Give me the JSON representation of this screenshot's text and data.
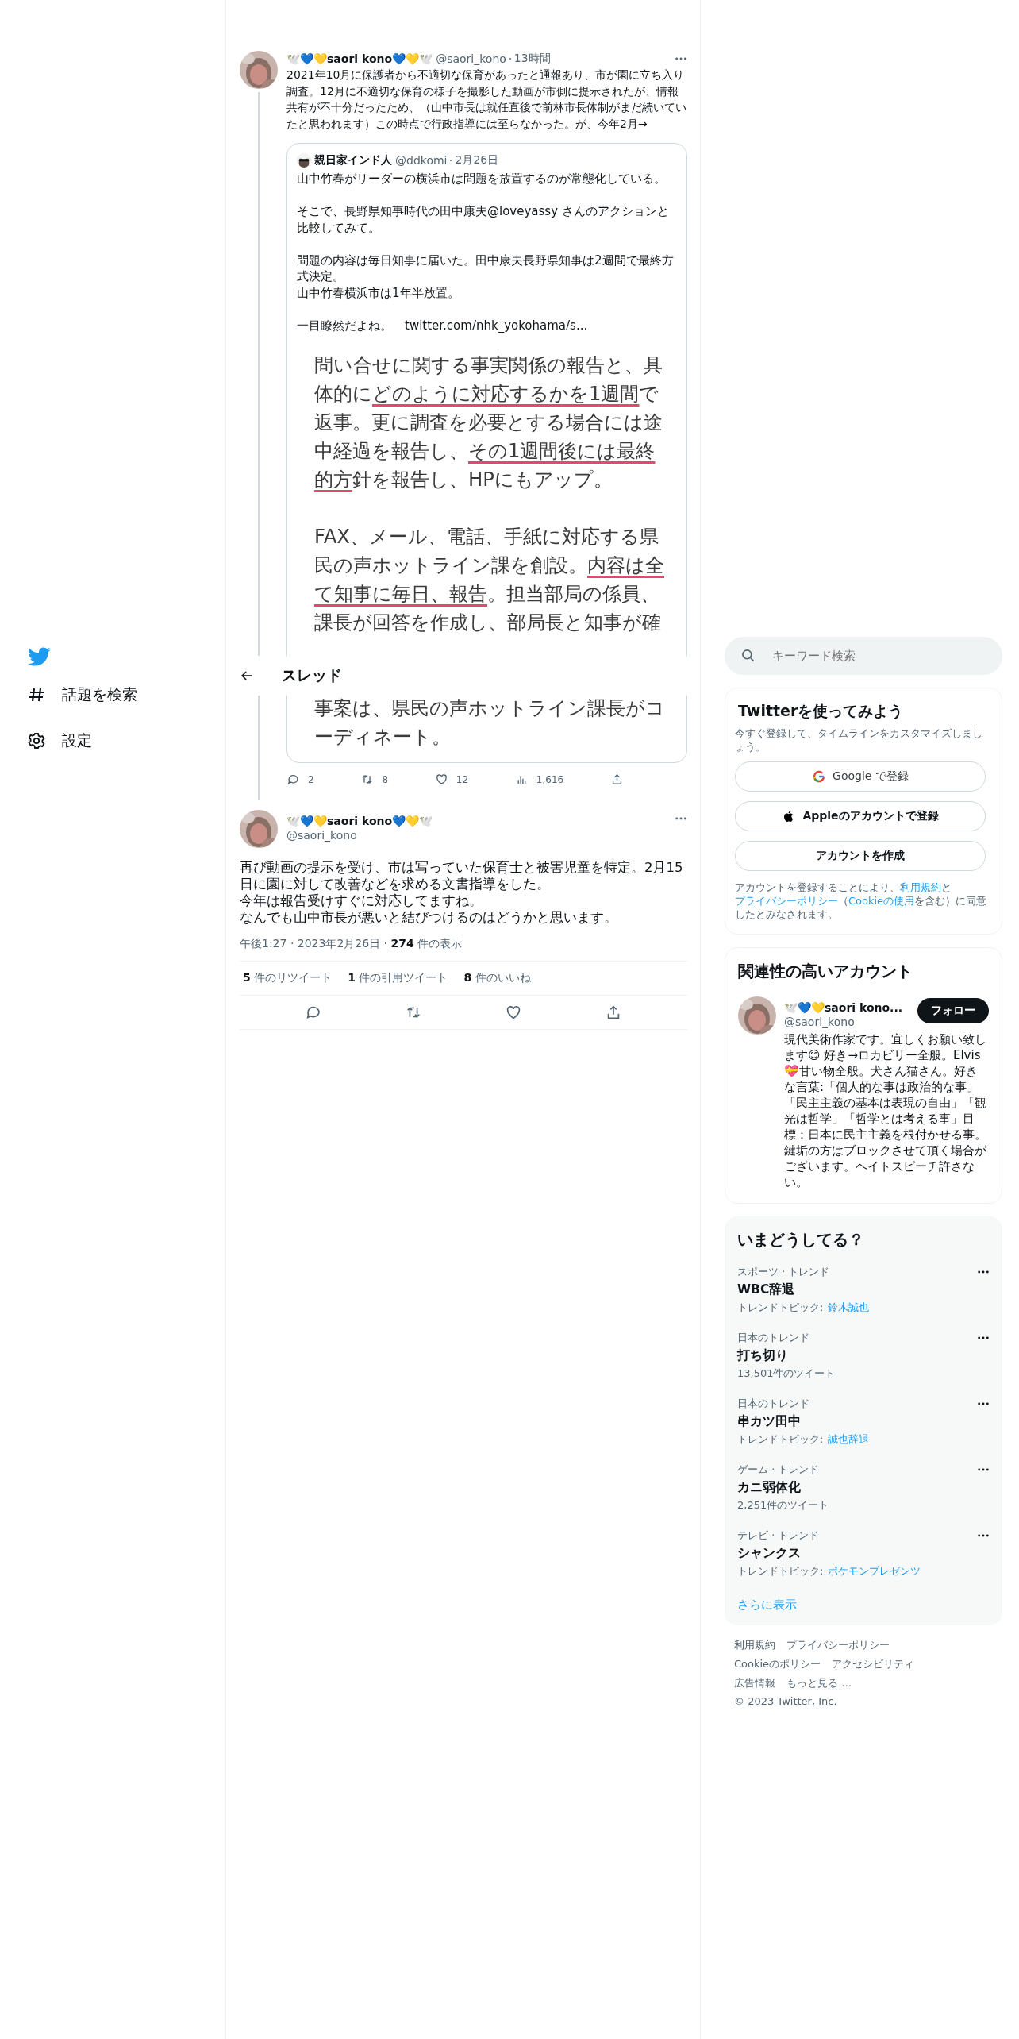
{
  "nav": {
    "items": [
      {
        "label": "話題を検索"
      },
      {
        "label": "設定"
      }
    ]
  },
  "header": {
    "title": "スレッド"
  },
  "tweets": [
    {
      "name": "🕊️💙💛saori kono💙💛🕊️",
      "handle": "@saori_kono",
      "time": "13時間",
      "text": "2021年10月に保護者から不適切な保育があったと通報あり、市が園に立ち入り調査。12月に不適切な保育の様子を撮影した動画が市側に提示されたが、情報共有が不十分だったため、（山中市長は就任直後で前林市長体制がまだ続いていたと思われます）この時点で行政指導には至らなかった。が、今年2月→",
      "quote": {
        "name": "親日家インド人",
        "handle": "@ddkomi",
        "date": "2月26日",
        "paragraphs": [
          [
            "山中竹春がリーダーの横浜市は問題を放置するのが常態化している。"
          ],
          [
            "そこで、長野県知事時代の田中康夫@loveyassy さんのアクションと比較してみて。"
          ],
          [
            "問題の内容は毎日知事に届いた。田中康夫長野県知事は2週間で最終方式決定。",
            "山中竹春横浜市は1年半放置。"
          ],
          [
            "一目瞭然だよね。"
          ]
        ],
        "link": "twitter.com/nhk_yokohama/s...",
        "image": {
          "paragraphs": [
            [
              [
                {
                  "text": "問い合せに関する事実関係の報告と、具",
                  "underline": false
                }
              ],
              [
                {
                  "text": "体的に",
                  "underline": false
                },
                {
                  "text": "どのように対応するかを1週間",
                  "underline": true
                },
                {
                  "text": "で",
                  "underline": false
                }
              ],
              [
                {
                  "text": "返事。更に調査を必要とする場合には途",
                  "underline": false
                }
              ],
              [
                {
                  "text": "中経過を報告し、",
                  "underline": false
                },
                {
                  "text": "その1週間後には最終",
                  "underline": true
                }
              ],
              [
                {
                  "text": "的方",
                  "underline": true
                },
                {
                  "text": "針を報告し、HPにもアップ。",
                  "underline": false
                }
              ]
            ],
            [
              [
                {
                  "text": "FAX、メール、電話、手紙に対応する県",
                  "underline": false
                }
              ],
              [
                {
                  "text": "民の声ホットライン課を創設。",
                  "underline": false
                },
                {
                  "text": "内容は全",
                  "underline": true
                }
              ],
              [
                {
                  "text": "て知事に毎日、報告",
                  "underline": true
                },
                {
                  "text": "。担当部局の係員、",
                  "underline": false
                }
              ],
              [
                {
                  "text": "課長が回答を作成し、部局長と知事が確",
                  "underline": false
                }
              ]
            ],
            [
              [
                {
                  "text": "事案は、県民の声ホットライン課長がコ",
                  "underline": false
                }
              ],
              [
                {
                  "text": "ーディネート。",
                  "underline": false
                }
              ]
            ]
          ]
        }
      },
      "actions": [
        {
          "kind": "reply",
          "count": "2"
        },
        {
          "kind": "retweet",
          "count": "8"
        },
        {
          "kind": "like",
          "count": "12"
        },
        {
          "kind": "views",
          "count": "1,616"
        },
        {
          "kind": "share"
        }
      ]
    },
    {
      "name": "🕊️💙💛saori kono💙💛🕊️",
      "handle": "@saori_kono",
      "lines": [
        "再び動画の提示を受け、市は写っていた保育士と被害児童を特定。2月15日に園に対して改善などを求める文書指導をした。",
        "今年は報告受けすぐに対応してますね。",
        "なんでも山中市長が悪いと結びつけるのはどうかと思います。"
      ],
      "timestamp": "午後1:27 · 2023年2月26日 · **274** 件の表示",
      "stats": [
        "**5** 件のリツイート",
        "**1** 件の引用ツイート",
        "**8** 件のいいね"
      ],
      "actions": [
        {
          "kind": "reply"
        },
        {
          "kind": "retweet"
        },
        {
          "kind": "like"
        },
        {
          "kind": "share"
        }
      ]
    }
  ],
  "search": {
    "placeholder": "キーワード検索"
  },
  "signup": {
    "title": "Twitterを使ってみよう",
    "subtitle": "今すぐ登録して、タイムラインをカスタマイズしましょう。",
    "buttons": [
      {
        "kind": "google",
        "label": "Google で登録"
      },
      {
        "kind": "apple",
        "label": "Appleのアカウントで登録"
      },
      {
        "kind": "plain",
        "label": "アカウントを作成"
      }
    ],
    "legal": [
      {
        "text": "アカウントを登録することにより、",
        "link": false
      },
      {
        "text": "利用規約",
        "link": true
      },
      {
        "text": "と",
        "link": false
      },
      {
        "text": "プライバシーポリシー",
        "link": true
      },
      {
        "text": "（",
        "link": false
      },
      {
        "text": "Cookieの使用",
        "link": true
      },
      {
        "text": "を含む）に同意したとみなされます。",
        "link": false
      }
    ]
  },
  "related": {
    "title": "関連性の高いアカウント",
    "account": {
      "name": "🕊️💙💛saori kono...",
      "handle": "@saori_kono",
      "button": "フォロー",
      "bio": "現代美術作家です。宜しくお願い致します😊 好き→ロカビリー全般。Elvis💝甘い物全般。犬さん猫さん。好きな言葉:「個人的な事は政治的な事」「民主主義の基本は表現の自由」「観光は哲学」「哲学とは考える事」目標：日本に民主主義を根付かせる事。鍵垢の方はブロックさせて頂く場合がございます。ヘイトスピーチ許さない。"
    }
  },
  "trends": {
    "title": "いまどうしてる？",
    "items": [
      {
        "context": "スポーツ · トレンド",
        "title": "WBC辞退",
        "meta": "トレンドトピック:",
        "topic": "鈴木誠也"
      },
      {
        "context": "日本のトレンド",
        "title": "打ち切り",
        "meta": "13,501件のツイート"
      },
      {
        "context": "日本のトレンド",
        "title": "串カツ田中",
        "meta": "トレンドトピック:",
        "topic": "誠也辞退"
      },
      {
        "context": "ゲーム · トレンド",
        "title": "カニ弱体化",
        "meta": "2,251件のツイート"
      },
      {
        "context": "テレビ · トレンド",
        "title": "シャンクス",
        "meta": "トレンドトピック:",
        "topic": "ポケモンプレゼンツ"
      }
    ],
    "more": "さらに表示"
  },
  "footer": {
    "links": [
      "利用規約",
      "プライバシーポリシー",
      "Cookieのポリシー",
      "アクセシビリティ",
      "広告情報",
      "もっと見る …"
    ],
    "copyright": "© 2023 Twitter, Inc."
  }
}
